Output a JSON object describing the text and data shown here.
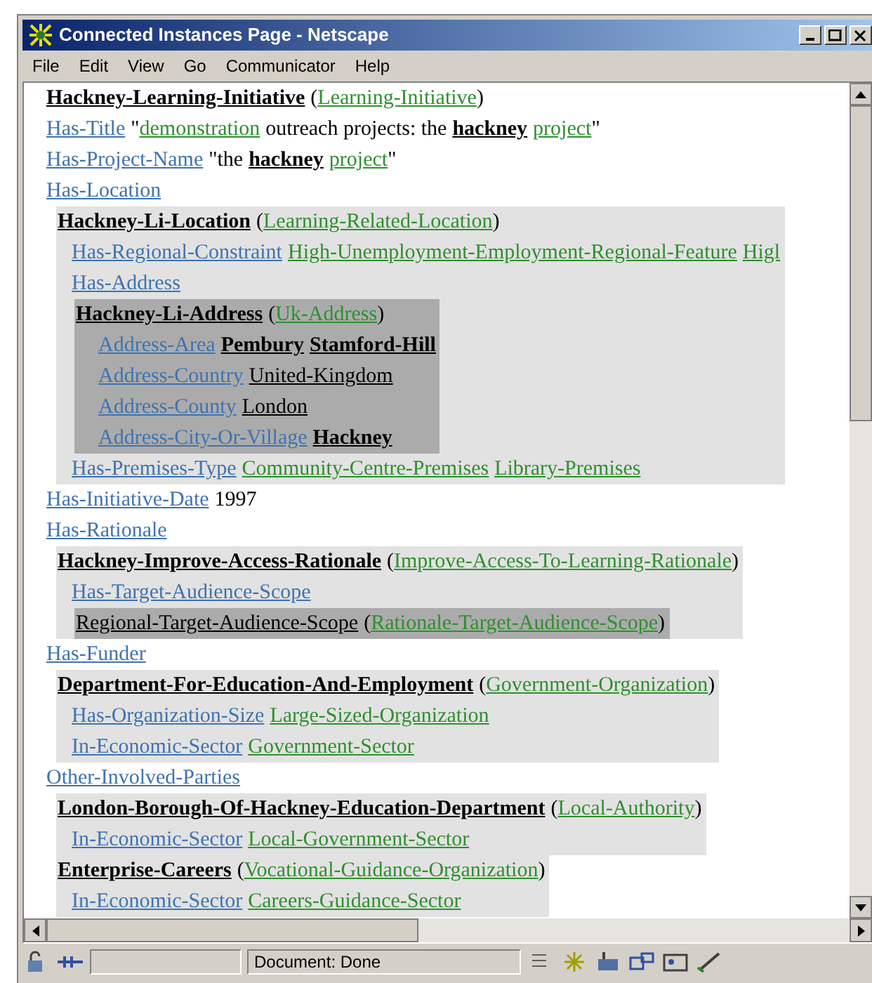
{
  "window": {
    "title": "Connected Instances Page - Netscape"
  },
  "menu": [
    "File",
    "Edit",
    "View",
    "Go",
    "Communicator",
    "Help"
  ],
  "content": [
    {
      "kind": "line",
      "segments": [
        {
          "kind": "instance",
          "text": "Hackney-Learning-Initiative"
        },
        {
          "kind": "text",
          "text": "("
        },
        {
          "kind": "class",
          "text": "Learning-Initiative",
          "tight": true
        },
        {
          "kind": "text",
          "text": ")",
          "tight": true
        }
      ]
    },
    {
      "kind": "line",
      "segments": [
        {
          "kind": "property",
          "text": "Has-Title"
        },
        {
          "kind": "text",
          "text": "\""
        },
        {
          "kind": "class",
          "text": "demonstration",
          "tight": true
        },
        {
          "kind": "text",
          "text": "outreach projects: the"
        },
        {
          "kind": "strong",
          "text": "hackney"
        },
        {
          "kind": "class",
          "text": "project"
        },
        {
          "kind": "text",
          "text": "\"",
          "tight": true
        }
      ]
    },
    {
      "kind": "line",
      "segments": [
        {
          "kind": "property",
          "text": "Has-Project-Name"
        },
        {
          "kind": "text",
          "text": "\"the"
        },
        {
          "kind": "strong",
          "text": "hackney"
        },
        {
          "kind": "class",
          "text": "project"
        },
        {
          "kind": "text",
          "text": "\"",
          "tight": true
        }
      ]
    },
    {
      "kind": "line",
      "segments": [
        {
          "kind": "property",
          "text": "Has-Location"
        }
      ]
    },
    {
      "kind": "block",
      "children": [
        {
          "kind": "line",
          "segments": [
            {
              "kind": "instance",
              "text": "Hackney-Li-Location"
            },
            {
              "kind": "text",
              "text": "("
            },
            {
              "kind": "class",
              "text": "Learning-Related-Location",
              "tight": true
            },
            {
              "kind": "text",
              "text": ")",
              "tight": true
            }
          ]
        },
        {
          "kind": "line",
          "segments": [
            {
              "kind": "property",
              "text": "Has-Regional-Constraint"
            },
            {
              "kind": "class",
              "text": "High-Unemployment-Employment-Regional-Feature"
            },
            {
              "kind": "class",
              "text": "Higl"
            }
          ]
        },
        {
          "kind": "line",
          "segments": [
            {
              "kind": "property",
              "text": "Has-Address"
            }
          ]
        },
        {
          "kind": "block",
          "children": [
            {
              "kind": "line",
              "segments": [
                {
                  "kind": "instance",
                  "text": "Hackney-Li-Address"
                },
                {
                  "kind": "text",
                  "text": "("
                },
                {
                  "kind": "class",
                  "text": "Uk-Address",
                  "tight": true
                },
                {
                  "kind": "text",
                  "text": ")",
                  "tight": true
                }
              ]
            },
            {
              "kind": "line",
              "segments": [
                {
                  "kind": "property",
                  "text": "Address-Area"
                },
                {
                  "kind": "strong",
                  "text": "Pembury"
                },
                {
                  "kind": "strong",
                  "text": "Stamford-Hill"
                }
              ]
            },
            {
              "kind": "line",
              "segments": [
                {
                  "kind": "property",
                  "text": "Address-Country"
                },
                {
                  "kind": "literal",
                  "text": "United-Kingdom"
                }
              ]
            },
            {
              "kind": "line",
              "segments": [
                {
                  "kind": "property",
                  "text": "Address-County"
                },
                {
                  "kind": "literal",
                  "text": "London"
                }
              ]
            },
            {
              "kind": "line",
              "segments": [
                {
                  "kind": "property",
                  "text": "Address-City-Or-Village"
                },
                {
                  "kind": "strong",
                  "text": "Hackney"
                }
              ]
            }
          ]
        },
        {
          "kind": "line",
          "segments": [
            {
              "kind": "property",
              "text": "Has-Premises-Type"
            },
            {
              "kind": "class",
              "text": "Community-Centre-Premises"
            },
            {
              "kind": "class",
              "text": "Library-Premises"
            }
          ]
        }
      ]
    },
    {
      "kind": "line",
      "segments": [
        {
          "kind": "property",
          "text": "Has-Initiative-Date"
        },
        {
          "kind": "text",
          "text": "1997"
        }
      ]
    },
    {
      "kind": "line",
      "segments": [
        {
          "kind": "property",
          "text": "Has-Rationale"
        }
      ]
    },
    {
      "kind": "block",
      "children": [
        {
          "kind": "line",
          "segments": [
            {
              "kind": "instance",
              "text": "Hackney-Improve-Access-Rationale"
            },
            {
              "kind": "text",
              "text": "("
            },
            {
              "kind": "class",
              "text": "Improve-Access-To-Learning-Rationale",
              "tight": true
            },
            {
              "kind": "text",
              "text": ")",
              "tight": true
            }
          ]
        },
        {
          "kind": "line",
          "segments": [
            {
              "kind": "property",
              "text": "Has-Target-Audience-Scope"
            }
          ]
        },
        {
          "kind": "block",
          "children": [
            {
              "kind": "line",
              "segments": [
                {
                  "kind": "literal",
                  "text": "Regional-Target-Audience-Scope"
                },
                {
                  "kind": "text",
                  "text": "("
                },
                {
                  "kind": "class",
                  "text": "Rationale-Target-Audience-Scope",
                  "tight": true
                },
                {
                  "kind": "text",
                  "text": ")",
                  "tight": true
                }
              ]
            }
          ]
        }
      ]
    },
    {
      "kind": "line",
      "segments": [
        {
          "kind": "property",
          "text": "Has-Funder"
        }
      ]
    },
    {
      "kind": "block",
      "children": [
        {
          "kind": "line",
          "segments": [
            {
              "kind": "instance",
              "text": "Department-For-Education-And-Employment"
            },
            {
              "kind": "text",
              "text": "("
            },
            {
              "kind": "class",
              "text": "Government-Organization",
              "tight": true
            },
            {
              "kind": "text",
              "text": ")",
              "tight": true
            }
          ]
        },
        {
          "kind": "line",
          "segments": [
            {
              "kind": "property",
              "text": "Has-Organization-Size"
            },
            {
              "kind": "class",
              "text": "Large-Sized-Organization"
            }
          ]
        },
        {
          "kind": "line",
          "segments": [
            {
              "kind": "property",
              "text": "In-Economic-Sector"
            },
            {
              "kind": "class",
              "text": "Government-Sector"
            }
          ]
        }
      ]
    },
    {
      "kind": "line",
      "segments": [
        {
          "kind": "property",
          "text": "Other-Involved-Parties"
        }
      ]
    },
    {
      "kind": "block",
      "children": [
        {
          "kind": "line",
          "segments": [
            {
              "kind": "instance",
              "text": "London-Borough-Of-Hackney-Education-Department"
            },
            {
              "kind": "text",
              "text": "("
            },
            {
              "kind": "class",
              "text": "Local-Authority",
              "tight": true
            },
            {
              "kind": "text",
              "text": ")",
              "tight": true
            }
          ]
        },
        {
          "kind": "line",
          "segments": [
            {
              "kind": "property",
              "text": "In-Economic-Sector"
            },
            {
              "kind": "class",
              "text": "Local-Government-Sector"
            }
          ]
        }
      ]
    },
    {
      "kind": "block",
      "children": [
        {
          "kind": "line",
          "segments": [
            {
              "kind": "instance",
              "text": "Enterprise-Careers"
            },
            {
              "kind": "text",
              "text": "("
            },
            {
              "kind": "class",
              "text": "Vocational-Guidance-Organization",
              "tight": true
            },
            {
              "kind": "text",
              "text": ")",
              "tight": true
            }
          ]
        },
        {
          "kind": "line",
          "segments": [
            {
              "kind": "property",
              "text": "In-Economic-Sector"
            },
            {
              "kind": "class",
              "text": "Careers-Guidance-Sector"
            }
          ]
        }
      ]
    }
  ],
  "status_bar": {
    "text": "Document: Done"
  }
}
